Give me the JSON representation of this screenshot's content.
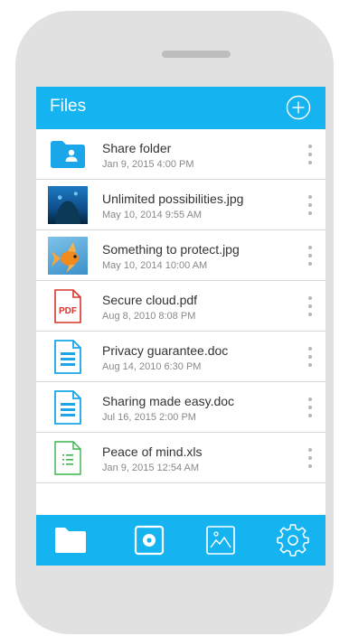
{
  "header": {
    "title": "Files",
    "add_icon": "plus-circle-icon"
  },
  "files": [
    {
      "name": "Share folder",
      "date": "Jan 9, 2015  4:00 PM",
      "icon": "shared-folder-icon"
    },
    {
      "name": "Unlimited possibilities.jpg",
      "date": "May 10, 2014  9:55 AM",
      "icon": "aquarium-photo-thumbnail"
    },
    {
      "name": "Something to protect.jpg",
      "date": "May 10, 2014  10:00 AM",
      "icon": "goldfish-photo-thumbnail"
    },
    {
      "name": "Secure cloud.pdf",
      "date": "Aug 8, 2010  8:08 PM",
      "icon": "pdf-file-icon",
      "icon_label": "PDF"
    },
    {
      "name": "Privacy guarantee.doc",
      "date": "Aug 14, 2010  6:30 PM",
      "icon": "doc-file-icon"
    },
    {
      "name": "Sharing made easy.doc",
      "date": "Jul 16, 2015  2:00 PM",
      "icon": "doc-file-icon"
    },
    {
      "name": "Peace of mind.xls",
      "date": "Jan 9, 2015  12:54 AM",
      "icon": "xls-file-icon"
    }
  ],
  "bottom_nav": [
    {
      "icon": "folder-icon",
      "active": true
    },
    {
      "icon": "safe-icon",
      "active": false
    },
    {
      "icon": "image-icon",
      "active": false
    },
    {
      "icon": "gear-icon",
      "active": false
    }
  ],
  "colors": {
    "accent": "#15b4f1",
    "phone_body": "#e1e1e1",
    "pdf_red": "#d9352b",
    "doc_blue": "#1aa6e8",
    "xls_green": "#3bb34a"
  }
}
